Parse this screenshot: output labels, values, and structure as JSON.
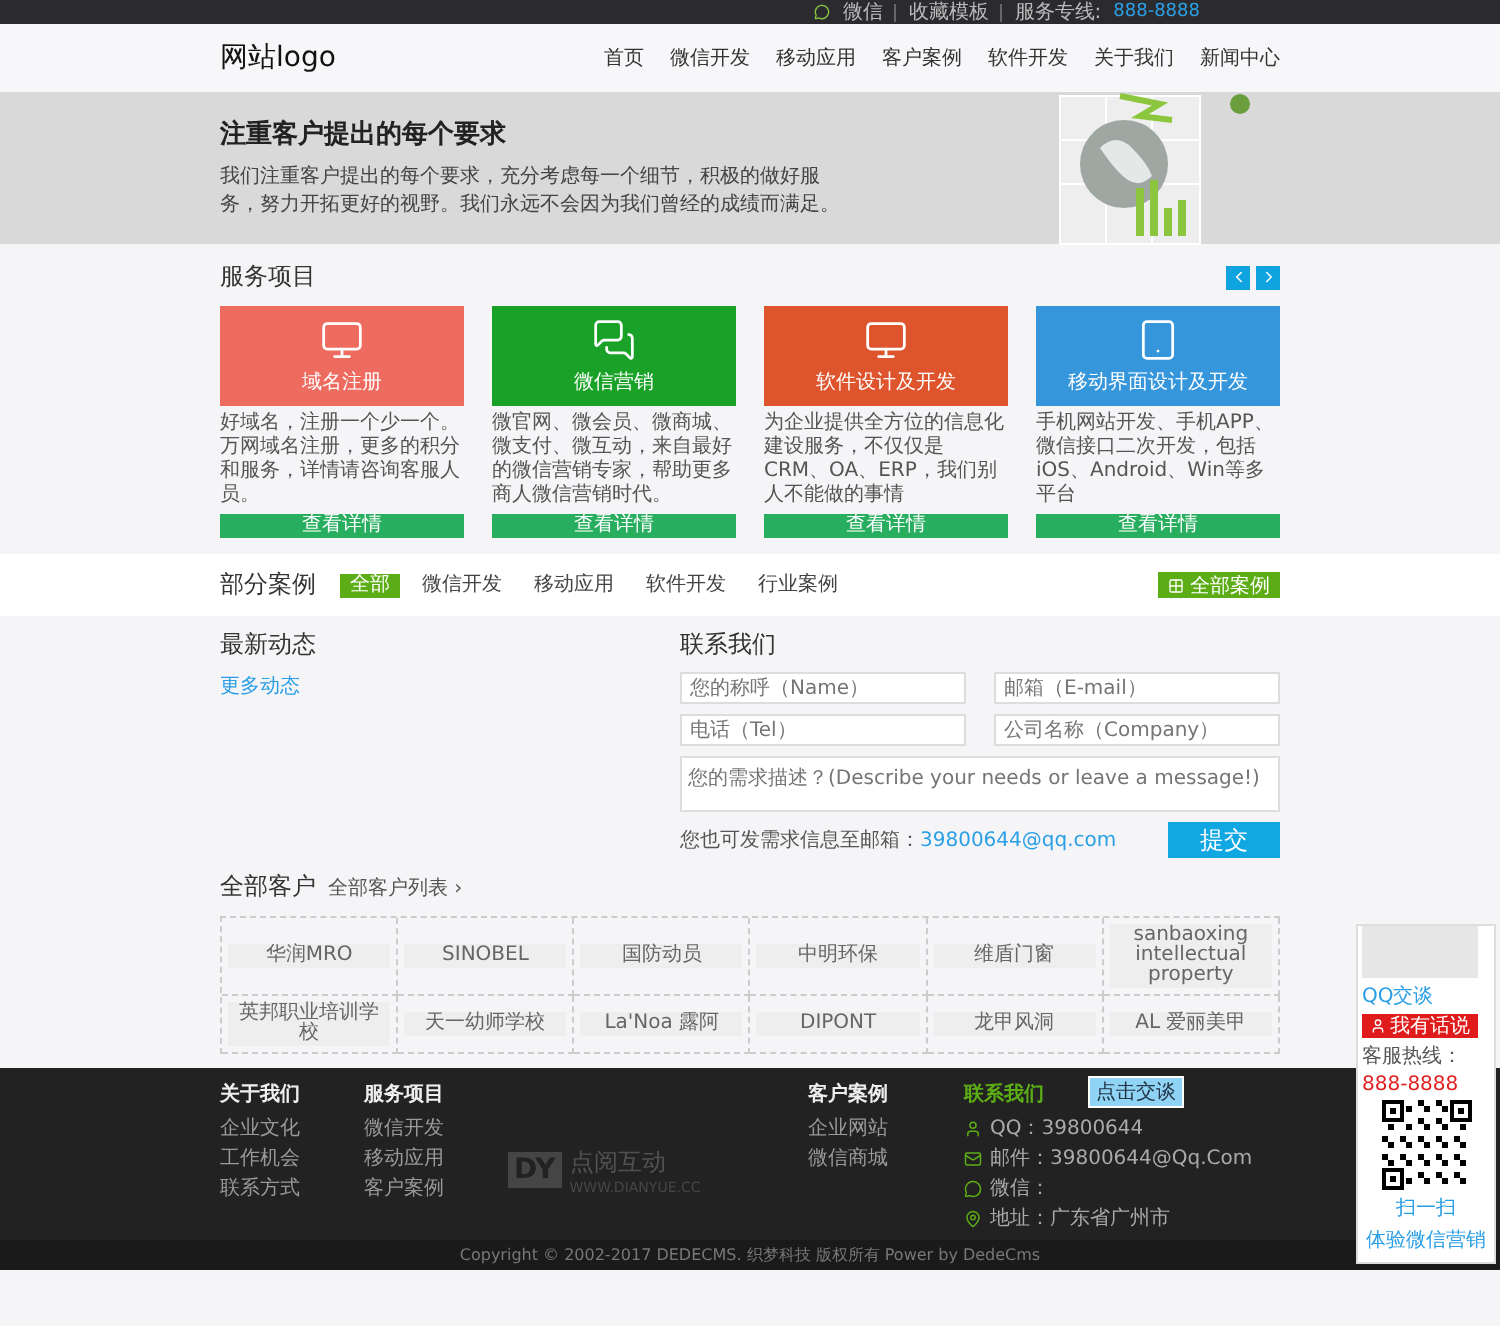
{
  "top_bar": {
    "wechat": "微信",
    "bookmark": "收藏模板",
    "hotline_label": "服务专线:",
    "hotline": "888-8888"
  },
  "header": {
    "logo": "网站logo",
    "nav": [
      "首页",
      "微信开发",
      "移动应用",
      "客户案例",
      "软件开发",
      "关于我们",
      "新闻中心"
    ]
  },
  "hero": {
    "title": "注重客户提出的每个要求",
    "text": "我们注重客户提出的每个要求，充分考虑每一个细节，积极的做好服务，努力开拓更好的视野。我们永远不会因为我们曾经的成绩而满足。"
  },
  "services": {
    "title": "服务项目",
    "items": [
      {
        "kind": "domain",
        "color": "#ee6b60",
        "title": "域名注册",
        "text": "好域名，注册一个少一个。万网域名注册，更多的积分和服务，详情请咨询客服人员。",
        "button": "查看详情"
      },
      {
        "kind": "wechat",
        "color": "#1aa228",
        "title": "微信营销",
        "text": "微官网、微会员、微商城、微支付、微互动，来自最好的微信营销专家，帮助更多商人微信营销时代。",
        "button": "查看详情"
      },
      {
        "kind": "software",
        "color": "#de542d",
        "title": "软件设计及开发",
        "text": "为企业提供全方位的信息化建设服务，不仅仅是CRM、OA、ERP，我们别人不能做的事情",
        "button": "查看详情"
      },
      {
        "kind": "mobile",
        "color": "#3596dc",
        "title": "移动界面设计及开发",
        "text": "手机网站开发、手机APP、微信接口二次开发，包括iOS、Android、Win等多平台",
        "button": "查看详情"
      }
    ]
  },
  "cases": {
    "title": "部分案例",
    "tabs": [
      {
        "label": "全部",
        "selected": true
      },
      {
        "label": "微信开发",
        "selected": false
      },
      {
        "label": "移动应用",
        "selected": false
      },
      {
        "label": "软件开发",
        "selected": false
      },
      {
        "label": "行业案例",
        "selected": false
      }
    ],
    "all_button": "全部案例"
  },
  "news": {
    "title": "最新动态",
    "more": "更多动态"
  },
  "contact_form": {
    "title": "联系我们",
    "fields": [
      {
        "placeholder": "您的称呼（Name）"
      },
      {
        "placeholder": "邮箱（E-mail）"
      },
      {
        "placeholder": "电话（Tel）"
      },
      {
        "placeholder": "公司名称（Company）"
      }
    ],
    "message_placeholder": "您的需求描述？(Describe your needs or leave a message!)",
    "note": "您也可发需求信息至邮箱：",
    "email": "39800644@qq.com",
    "submit": "提交"
  },
  "clients": {
    "title": "全部客户",
    "link": "全部客户列表 ›",
    "logos": [
      "华润MRO",
      "SINOBEL",
      "国防动员",
      "中明环保",
      "维盾门窗",
      "sanbaoxing intellectual property",
      "英邦职业培训学校",
      "天一幼师学校",
      "La'Noa 露阿",
      "DIPONT",
      "龙甲风洞",
      "AL 爱丽美甲"
    ]
  },
  "footer": {
    "sections": [
      {
        "kind": "links",
        "title": "关于我们",
        "links": [
          "企业文化",
          "工作机会",
          "联系方式"
        ]
      },
      {
        "kind": "links",
        "title": "服务项目",
        "links": [
          "微信开发",
          "移动应用",
          "客户案例"
        ]
      },
      {
        "kind": "brand",
        "mark": "DY",
        "name": "点阅互动",
        "url": "WWW.DIANYUE.CC"
      },
      {
        "kind": "links",
        "title": "客户案例",
        "links": [
          "企业网站",
          "微信商城"
        ]
      },
      {
        "kind": "contact",
        "title": "联系我们",
        "chat_badge": "点击交谈",
        "items": [
          {
            "kind": "qq",
            "text": "QQ：39800644"
          },
          {
            "kind": "mail",
            "text": "邮件：39800644@Qq.Com"
          },
          {
            "kind": "wechat",
            "text": "微信："
          },
          {
            "kind": "location",
            "text": "地址：广东省广州市"
          }
        ]
      }
    ]
  },
  "copyright": "Copyright © 2002-2017 DEDECMS. 织梦科技 版权所有 Power by DedeCms",
  "float_panel": {
    "qq_chat": "QQ交谈",
    "talk_button": "我有话说",
    "hotline_label": "客服热线：",
    "hotline": "888-8888",
    "scan": "扫一扫",
    "scan_note": "体验微信营销"
  }
}
